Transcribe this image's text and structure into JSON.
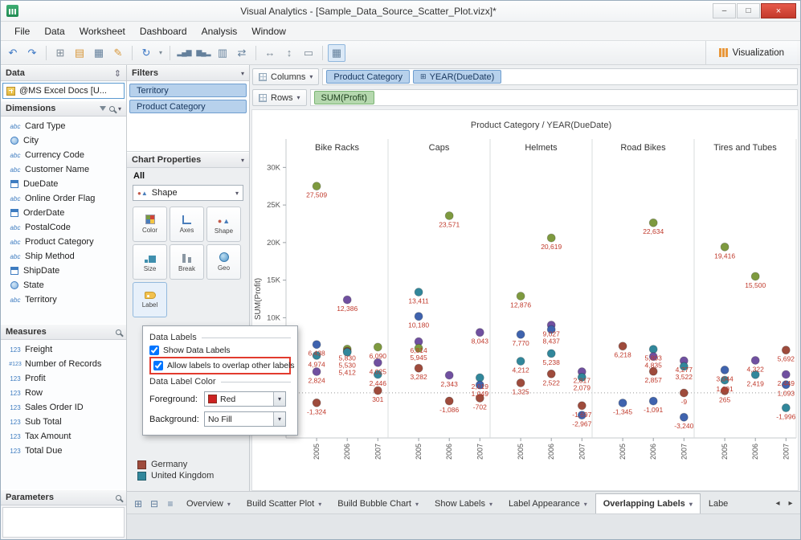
{
  "window": {
    "title": "Visual Analytics - [Sample_Data_Source_Scatter_Plot.vizx]*",
    "minimize": "–",
    "maximize": "□",
    "close": "×"
  },
  "icons": {
    "chevron_down": "▾",
    "sort_updown": "⇕",
    "expand": "⊞",
    "new_sheet": "⊞",
    "new_dashboard": "⊟",
    "list": "≡",
    "arrow_left": "◂",
    "arrow_right": "▸"
  },
  "menu": [
    "File",
    "Data",
    "Worksheet",
    "Dashboard",
    "Analysis",
    "Window"
  ],
  "toolbar": {
    "visualization": "Visualization",
    "icons": [
      {
        "name": "undo-icon",
        "glyph": "↶",
        "cls": "c-blue"
      },
      {
        "name": "redo-icon",
        "glyph": "↷",
        "cls": "c-blue"
      },
      {
        "sep": true
      },
      {
        "name": "new-worksheet-icon",
        "glyph": "⊞",
        "cls": "c-slate"
      },
      {
        "name": "open-icon",
        "glyph": "▤",
        "cls": "c-amber"
      },
      {
        "name": "save-icon",
        "glyph": "▦",
        "cls": "c-steel"
      },
      {
        "name": "format-icon",
        "glyph": "✎",
        "cls": "c-amber"
      },
      {
        "sep": true
      },
      {
        "name": "refresh-icon",
        "glyph": "↻",
        "cls": "c-blue"
      },
      {
        "name": "refresh-menu-icon",
        "glyph": "▾",
        "cls": "c-slate xs"
      },
      {
        "sep": true
      },
      {
        "name": "sort-ascending-icon",
        "glyph": "▂▄▆",
        "cls": "c-steel barsz"
      },
      {
        "name": "sort-descending-icon",
        "glyph": "▆▄▂",
        "cls": "c-steel barsz"
      },
      {
        "name": "group-fields-icon",
        "glyph": "▥",
        "cls": "c-steel"
      },
      {
        "name": "swap-axes-icon",
        "glyph": "⇄",
        "cls": "c-steel"
      },
      {
        "sep": true
      },
      {
        "name": "fit-width-icon",
        "glyph": "↔",
        "cls": "c-slate"
      },
      {
        "name": "fit-height-icon",
        "glyph": "↕",
        "cls": "c-slate"
      },
      {
        "name": "normal-view-icon",
        "glyph": "▭",
        "cls": "c-slate"
      },
      {
        "sep": true
      },
      {
        "name": "highlight-icon",
        "glyph": "▦",
        "cls": "c-steel pressed"
      }
    ]
  },
  "data_panel": {
    "title": "Data",
    "source": "@MS Excel Docs [U...",
    "dimensions": {
      "title": "Dimensions",
      "items": [
        {
          "icon": "abc",
          "label": "Card Type"
        },
        {
          "icon": "globe",
          "label": "City"
        },
        {
          "icon": "abc",
          "label": "Currency Code"
        },
        {
          "icon": "abc",
          "label": "Customer Name"
        },
        {
          "icon": "calendar",
          "label": "DueDate"
        },
        {
          "icon": "abc",
          "label": "Online Order Flag"
        },
        {
          "icon": "calendar",
          "label": "OrderDate"
        },
        {
          "icon": "abc",
          "label": "PostalCode"
        },
        {
          "icon": "abc",
          "label": "Product Category"
        },
        {
          "icon": "abc",
          "label": "Ship Method"
        },
        {
          "icon": "calendar",
          "label": "ShipDate"
        },
        {
          "icon": "globe",
          "label": "State"
        },
        {
          "icon": "abc",
          "label": "Territory"
        }
      ]
    },
    "measures": {
      "title": "Measures",
      "items": [
        {
          "icon": "num",
          "label": "Freight"
        },
        {
          "icon": "numrec",
          "label": "Number of Records"
        },
        {
          "icon": "num",
          "label": "Profit"
        },
        {
          "icon": "num",
          "label": "Row"
        },
        {
          "icon": "num",
          "label": "Sales Order ID"
        },
        {
          "icon": "num",
          "label": "Sub Total"
        },
        {
          "icon": "num",
          "label": "Tax Amount"
        },
        {
          "icon": "num",
          "label": "Total Due"
        }
      ]
    },
    "parameters": {
      "title": "Parameters"
    }
  },
  "filters_panel": {
    "title": "Filters",
    "pills": [
      "Territory",
      "Product Category"
    ]
  },
  "chart_properties": {
    "title": "Chart Properties",
    "scope": "All",
    "shape_dropdown": "Shape",
    "buttons": [
      "Color",
      "Axes",
      "Shape",
      "Size",
      "Break",
      "Geo",
      "Label"
    ]
  },
  "label_popup": {
    "group1": "Data Labels",
    "checkbox1": "Show Data Labels",
    "checkbox1_checked": "checked",
    "checkbox2": "Allow labels to overlap other labels",
    "checkbox2_checked": "checked",
    "group2": "Data Label Color",
    "foreground_label": "Foreground:",
    "foreground_value": "Red",
    "foreground_color": "#cc2222",
    "background_label": "Background:",
    "background_value": "No Fill"
  },
  "legend": {
    "items": [
      {
        "label": "Germany",
        "color": "#9e4b3c"
      },
      {
        "label": "United Kingdom",
        "color": "#31879b"
      }
    ]
  },
  "shelves": {
    "columns_label": "Columns",
    "columns_pills": [
      "Product Category",
      "YEAR(DueDate)"
    ],
    "rows_label": "Rows",
    "rows_pills": [
      "SUM(Profit)"
    ]
  },
  "tabbar": {
    "tabs": [
      {
        "name": "tab-overview",
        "label": "Overview"
      },
      {
        "name": "tab-build-scatter-plot",
        "label": "Build Scatter Plot"
      },
      {
        "name": "tab-build-bubble-chart",
        "label": "Build Bubble Chart"
      },
      {
        "name": "tab-show-labels",
        "label": "Show Labels"
      },
      {
        "name": "tab-label-appearance",
        "label": "Label Appearance"
      },
      {
        "name": "tab-overlapping-labels",
        "label": "Overlapping Labels",
        "active": true
      },
      {
        "name": "tab-clipped",
        "label": "Labe",
        "cls": "clipped"
      }
    ]
  },
  "chart_data": {
    "type": "scatter",
    "title": "Product Category / YEAR(DueDate)",
    "ylabel": "SUM(Profit)",
    "ymax": 31000,
    "ymin": -6000,
    "grid": false,
    "zero_line": "dotted",
    "label_color": "#c0392b",
    "yticks": [
      {
        "v": 30000,
        "label": "30K"
      },
      {
        "v": 25000,
        "label": "25K"
      },
      {
        "v": 20000,
        "label": "20K"
      },
      {
        "v": 15000,
        "label": "15K"
      },
      {
        "v": 10000,
        "label": "10K"
      }
    ],
    "years": [
      "2005",
      "2006",
      "2007"
    ],
    "series_colors": {
      "green": "#7e9a3f",
      "maroon": "#9e4b3c",
      "teal": "#31879b",
      "blue": "#3f63ae",
      "purple": "#7050a0"
    },
    "panels": [
      {
        "name": "Bike Racks",
        "points": [
          {
            "year": "2005",
            "value": 27509,
            "color": "green"
          },
          {
            "year": "2005",
            "value": 6438,
            "color": "blue"
          },
          {
            "year": "2005",
            "value": 4974,
            "color": "teal"
          },
          {
            "year": "2005",
            "value": 2824,
            "color": "purple"
          },
          {
            "year": "2005",
            "value": -1324,
            "color": "maroon"
          },
          {
            "year": "2006",
            "value": 12386,
            "color": "purple"
          },
          {
            "year": "2006",
            "value": 5830,
            "color": "green"
          },
          {
            "year": "2006",
            "value": 5530,
            "color": "maroon"
          },
          {
            "year": "2006",
            "value": 5412,
            "color": "teal"
          },
          {
            "year": "2007",
            "value": 6090,
            "color": "green"
          },
          {
            "year": "2007",
            "value": 4025,
            "color": "purple"
          },
          {
            "year": "2007",
            "value": 2446,
            "color": "teal"
          },
          {
            "year": "2007",
            "value": 301,
            "color": "maroon"
          }
        ]
      },
      {
        "name": "Caps",
        "points": [
          {
            "year": "2005",
            "value": 13411,
            "color": "teal"
          },
          {
            "year": "2005",
            "value": 10180,
            "color": "blue"
          },
          {
            "year": "2005",
            "value": 6814,
            "color": "purple"
          },
          {
            "year": "2005",
            "value": 5945,
            "color": "green"
          },
          {
            "year": "2005",
            "value": 3282,
            "color": "maroon"
          },
          {
            "year": "2006",
            "value": 23571,
            "color": "green"
          },
          {
            "year": "2006",
            "value": 2343,
            "color": "purple"
          },
          {
            "year": "2006",
            "value": -1086,
            "color": "maroon"
          },
          {
            "year": "2007",
            "value": 8043,
            "color": "purple"
          },
          {
            "year": "2007",
            "value": 2019,
            "color": "teal"
          },
          {
            "year": "2007",
            "value": 1049,
            "color": "blue"
          },
          {
            "year": "2007",
            "value": -702,
            "color": "maroon"
          }
        ]
      },
      {
        "name": "Helmets",
        "points": [
          {
            "year": "2005",
            "value": 12876,
            "color": "green"
          },
          {
            "year": "2005",
            "value": 7770,
            "color": "blue"
          },
          {
            "year": "2005",
            "value": 4212,
            "color": "teal"
          },
          {
            "year": "2005",
            "value": 1325,
            "color": "maroon"
          },
          {
            "year": "2006",
            "value": 20619,
            "color": "green"
          },
          {
            "year": "2006",
            "value": 9027,
            "color": "purple"
          },
          {
            "year": "2006",
            "value": 8437,
            "color": "blue"
          },
          {
            "year": "2006",
            "value": 5238,
            "color": "teal"
          },
          {
            "year": "2006",
            "value": 2522,
            "color": "maroon"
          },
          {
            "year": "2007",
            "value": 2817,
            "color": "purple"
          },
          {
            "year": "2007",
            "value": 2079,
            "color": "teal"
          },
          {
            "year": "2007",
            "value": -1697,
            "color": "maroon"
          },
          {
            "year": "2007",
            "value": -2967,
            "color": "blue"
          }
        ]
      },
      {
        "name": "Road Bikes",
        "points": [
          {
            "year": "2005",
            "value": 6218,
            "color": "maroon"
          },
          {
            "year": "2005",
            "value": -1345,
            "color": "blue"
          },
          {
            "year": "2006",
            "value": 22634,
            "color": "green"
          },
          {
            "year": "2006",
            "value": 5803,
            "color": "teal"
          },
          {
            "year": "2006",
            "value": 4835,
            "color": "purple"
          },
          {
            "year": "2006",
            "value": 2857,
            "color": "maroon"
          },
          {
            "year": "2006",
            "value": -1091,
            "color": "blue"
          },
          {
            "year": "2007",
            "value": 4277,
            "color": "purple"
          },
          {
            "year": "2007",
            "value": 3522,
            "color": "teal"
          },
          {
            "year": "2007",
            "value": -9,
            "color": "maroon"
          },
          {
            "year": "2007",
            "value": -3240,
            "color": "blue"
          }
        ]
      },
      {
        "name": "Tires and Tubes",
        "points": [
          {
            "year": "2005",
            "value": 19416,
            "color": "green"
          },
          {
            "year": "2005",
            "value": 3044,
            "color": "blue"
          },
          {
            "year": "2005",
            "value": 1691,
            "color": "teal"
          },
          {
            "year": "2005",
            "value": 265,
            "color": "maroon"
          },
          {
            "year": "2006",
            "value": 15500,
            "color": "green"
          },
          {
            "year": "2006",
            "value": 4322,
            "color": "purple"
          },
          {
            "year": "2006",
            "value": 2419,
            "color": "teal"
          },
          {
            "year": "2007",
            "value": 5692,
            "color": "maroon"
          },
          {
            "year": "2007",
            "value": 2449,
            "color": "purple"
          },
          {
            "year": "2007",
            "value": 1093,
            "color": "blue"
          },
          {
            "year": "2007",
            "value": -1996,
            "color": "teal"
          }
        ]
      }
    ]
  }
}
